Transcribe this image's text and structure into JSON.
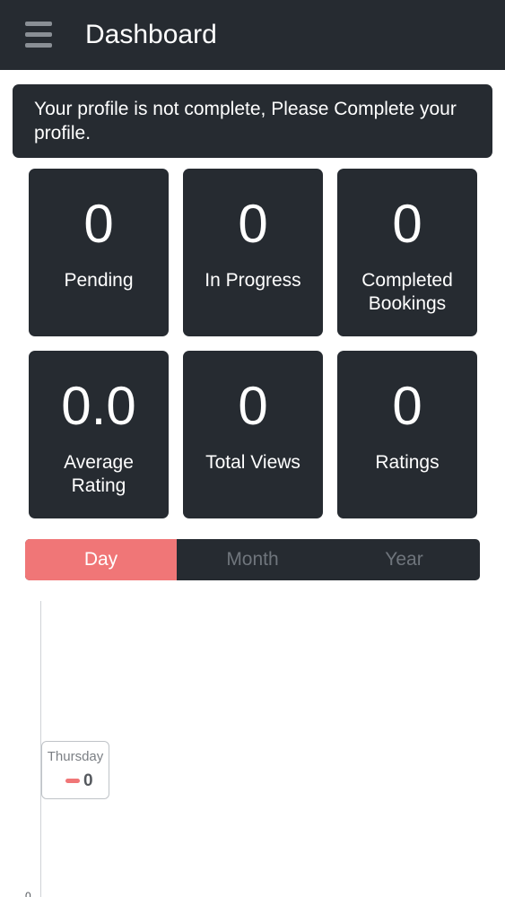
{
  "header": {
    "title": "Dashboard",
    "menu_icon": "hamburger-menu-icon"
  },
  "banner": {
    "text": "Your profile is not complete, Please Complete your profile."
  },
  "stats": [
    {
      "value": "0",
      "label": "Pending"
    },
    {
      "value": "0",
      "label": "In Progress"
    },
    {
      "value": "0",
      "label": "Completed Bookings"
    },
    {
      "value": "0.0",
      "label": "Average Rating"
    },
    {
      "value": "0",
      "label": "Total Views"
    },
    {
      "value": "0",
      "label": "Ratings"
    }
  ],
  "range_tabs": [
    {
      "label": "Day",
      "active": true
    },
    {
      "label": "Month",
      "active": false
    },
    {
      "label": "Year",
      "active": false
    }
  ],
  "colors": {
    "background_dark": "#262b31",
    "accent": "#f07677",
    "inactive_tab_text": "#6f757c"
  },
  "chart_data": {
    "type": "line",
    "categories": [
      "Thursday"
    ],
    "series": [
      {
        "values": [
          0
        ]
      }
    ],
    "tooltip": {
      "category": "Thursday",
      "value": "0"
    },
    "y_tick_labels": [
      "0"
    ]
  }
}
